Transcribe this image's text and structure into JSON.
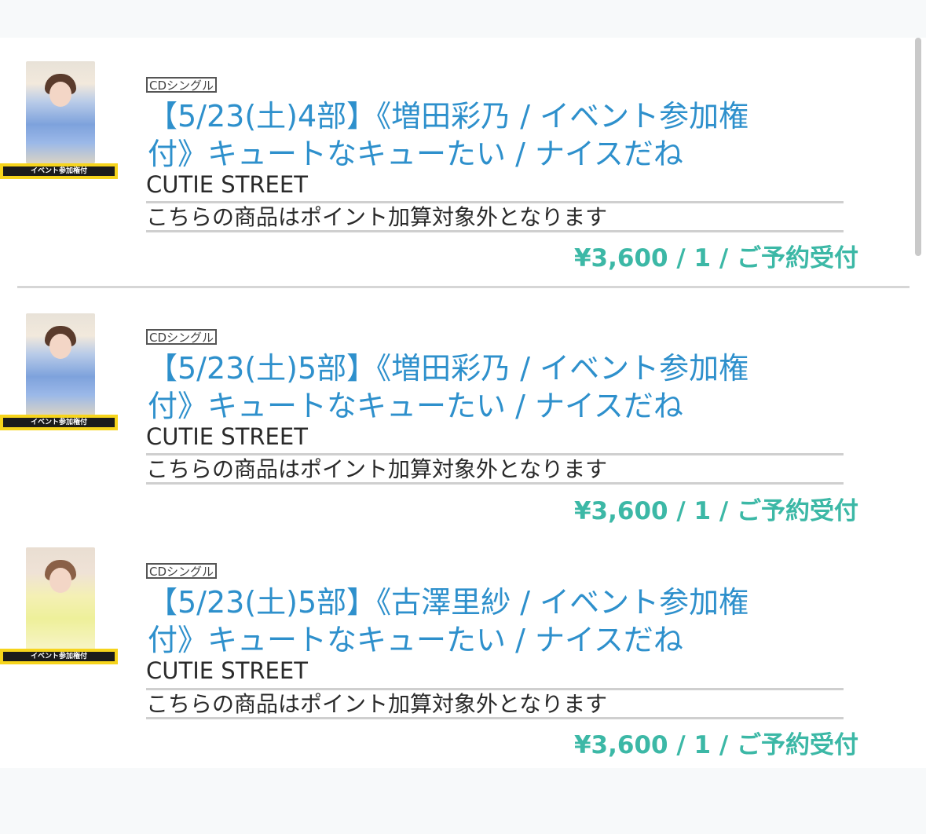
{
  "items": [
    {
      "type_tag": "CDシングル",
      "title_line1": "【5/23(土)4部】《増田彩乃 / イベント参加権",
      "title_line2": "付》キュートなキューたい / ナイスだね",
      "artist": "CUTIE STREET",
      "notice": "こちらの商品はポイント加算対象外となります",
      "price_line": "¥3,600 / 1 / ご予約受付",
      "badge": "イベント参加権付"
    },
    {
      "type_tag": "CDシングル",
      "title_line1": "【5/23(土)5部】《増田彩乃 / イベント参加権",
      "title_line2": "付》キュートなキューたい / ナイスだね",
      "artist": "CUTIE STREET",
      "notice": "こちらの商品はポイント加算対象外となります",
      "price_line": "¥3,600 / 1 / ご予約受付",
      "badge": "イベント参加権付"
    },
    {
      "type_tag": "CDシングル",
      "title_line1": "【5/23(土)5部】《古澤里紗 / イベント参加権",
      "title_line2": "付》キュートなキューたい / ナイスだね",
      "artist": "CUTIE STREET",
      "notice": "こちらの商品はポイント加算対象外となります",
      "price_line": "¥3,600 / 1 / ご予約受付",
      "badge": "イベント参加権付"
    }
  ],
  "colors": {
    "title": "#2e90cc",
    "price": "#3cb8a6",
    "badge_border": "#f6d41c"
  }
}
